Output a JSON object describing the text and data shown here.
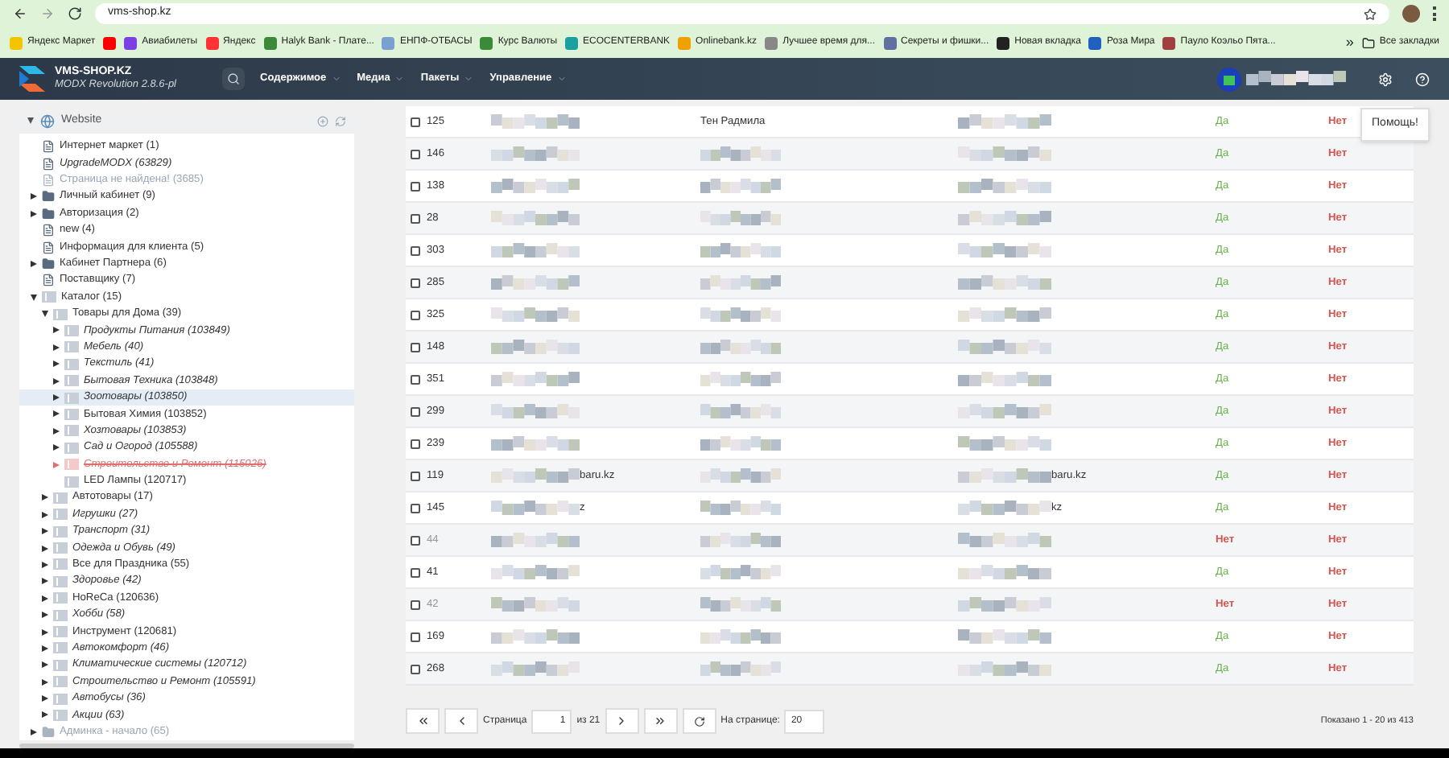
{
  "browser": {
    "address": "vms-shop.kz",
    "bookmarks": [
      {
        "kind": "link",
        "label": "Яндекс Маркет"
      },
      {
        "kind": "icon"
      },
      {
        "kind": "link",
        "label": "Авиабилеты"
      },
      {
        "kind": "link",
        "label": "Яндекс"
      },
      {
        "kind": "link",
        "label": "Halyk Bank - Плате..."
      },
      {
        "kind": "link",
        "label": "ЕНПФ-ОТБАСЫ"
      },
      {
        "kind": "link",
        "label": "Курс Валюты"
      },
      {
        "kind": "link",
        "label": "ECOCENTERBANK"
      },
      {
        "kind": "link",
        "label": "Onlinebank.kz"
      },
      {
        "kind": "link",
        "label": "Лучшее время для..."
      },
      {
        "kind": "link",
        "label": "Секреты и фишки..."
      },
      {
        "kind": "link",
        "label": "Новая вкладка"
      },
      {
        "kind": "link",
        "label": "Роза Мира"
      },
      {
        "kind": "link",
        "label": "Пауло Коэльо Пята..."
      }
    ],
    "more": "»",
    "all_bookmarks": "Все закладки"
  },
  "header": {
    "site": "VMS-SHOP.KZ",
    "version": "MODX Revolution 2.8.6-pl",
    "menu": [
      "Содержимое",
      "Медиа",
      "Пакеты",
      "Управление"
    ]
  },
  "tree": {
    "label": "Website",
    "expanded": true,
    "children": [
      {
        "label": "Интернет маркет (1)",
        "kind": "doc",
        "unpublished": false,
        "hidden": false,
        "deleted": false,
        "selected": false
      },
      {
        "label": "UpgradeMODX (63829)",
        "kind": "doc",
        "unpublished": true,
        "hidden": false,
        "deleted": false,
        "selected": false
      },
      {
        "label": "Страница не найдена! (3685)",
        "kind": "doc",
        "unpublished": false,
        "hidden": true,
        "deleted": false,
        "selected": false
      },
      {
        "label": "Личный кабинет (9)",
        "kind": "folder",
        "unpublished": false,
        "hidden": false,
        "deleted": false,
        "selected": false,
        "expanded": false
      },
      {
        "label": "Авторизация (2)",
        "kind": "folder",
        "unpublished": false,
        "hidden": false,
        "deleted": false,
        "selected": false,
        "expanded": false
      },
      {
        "label": "new (4)",
        "kind": "doc",
        "unpublished": false,
        "hidden": false,
        "deleted": false,
        "selected": false
      },
      {
        "label": "Информация для клиента (5)",
        "kind": "doc",
        "unpublished": false,
        "hidden": false,
        "deleted": false,
        "selected": false
      },
      {
        "label": "Кабинет Партнера (6)",
        "kind": "folder",
        "unpublished": false,
        "hidden": false,
        "deleted": false,
        "selected": false,
        "expanded": false
      },
      {
        "label": "Поставщику (7)",
        "kind": "doc",
        "unpublished": false,
        "hidden": false,
        "deleted": false,
        "selected": false
      },
      {
        "label": "Каталог (15)",
        "kind": "category",
        "unpublished": false,
        "hidden": false,
        "deleted": false,
        "selected": false,
        "expanded": true,
        "children": [
          {
            "label": "Товары для Дома (39)",
            "kind": "category",
            "unpublished": false,
            "hidden": false,
            "deleted": false,
            "selected": false,
            "expanded": true,
            "children": [
              {
                "label": "Продукты Питания (103849)",
                "kind": "category",
                "unpublished": true,
                "hidden": false,
                "deleted": false,
                "selected": false,
                "expanded": false
              },
              {
                "label": "Мебель (40)",
                "kind": "category",
                "unpublished": true,
                "hidden": false,
                "deleted": false,
                "selected": false,
                "expanded": false
              },
              {
                "label": "Текстиль (41)",
                "kind": "category",
                "unpublished": true,
                "hidden": false,
                "deleted": false,
                "selected": false,
                "expanded": false
              },
              {
                "label": "Бытовая Техника (103848)",
                "kind": "category",
                "unpublished": true,
                "hidden": false,
                "deleted": false,
                "selected": false,
                "expanded": false
              },
              {
                "label": "Зоотовары (103850)",
                "kind": "category",
                "unpublished": true,
                "hidden": false,
                "deleted": false,
                "selected": true,
                "expanded": false
              },
              {
                "label": "Бытовая Химия (103852)",
                "kind": "category",
                "unpublished": false,
                "hidden": false,
                "deleted": false,
                "selected": false,
                "expanded": false
              },
              {
                "label": "Хозтовары (103853)",
                "kind": "category",
                "unpublished": true,
                "hidden": false,
                "deleted": false,
                "selected": false,
                "expanded": false
              },
              {
                "label": "Сад и Огород (105588)",
                "kind": "category",
                "unpublished": true,
                "hidden": false,
                "deleted": false,
                "selected": false,
                "expanded": false
              },
              {
                "label": "Строительство и Ремонт (115026)",
                "kind": "category",
                "unpublished": true,
                "hidden": false,
                "deleted": true,
                "selected": false,
                "expanded": false
              },
              {
                "label": "LED Лампы (120717)",
                "kind": "category",
                "unpublished": false,
                "hidden": false,
                "deleted": false,
                "selected": false
              }
            ]
          },
          {
            "label": "Автотовары (17)",
            "kind": "category",
            "unpublished": false,
            "hidden": false,
            "deleted": false,
            "selected": false,
            "expanded": false
          },
          {
            "label": "Игрушки (27)",
            "kind": "category",
            "unpublished": true,
            "hidden": false,
            "deleted": false,
            "selected": false,
            "expanded": false
          },
          {
            "label": "Транспорт (31)",
            "kind": "category",
            "unpublished": true,
            "hidden": false,
            "deleted": false,
            "selected": false,
            "expanded": false
          },
          {
            "label": "Одежда и Обувь (49)",
            "kind": "category",
            "unpublished": true,
            "hidden": false,
            "deleted": false,
            "selected": false,
            "expanded": false
          },
          {
            "label": "Все для Праздника (55)",
            "kind": "category",
            "unpublished": false,
            "hidden": false,
            "deleted": false,
            "selected": false,
            "expanded": false
          },
          {
            "label": "Здоровье (42)",
            "kind": "category",
            "unpublished": true,
            "hidden": false,
            "deleted": false,
            "selected": false,
            "expanded": false
          },
          {
            "label": "HoReCa (120636)",
            "kind": "category",
            "unpublished": false,
            "hidden": false,
            "deleted": false,
            "selected": false,
            "expanded": false
          },
          {
            "label": "Хобби (58)",
            "kind": "category",
            "unpublished": true,
            "hidden": false,
            "deleted": false,
            "selected": false,
            "expanded": false
          },
          {
            "label": "Инструмент (120681)",
            "kind": "category",
            "unpublished": false,
            "hidden": false,
            "deleted": false,
            "selected": false,
            "expanded": false
          },
          {
            "label": "Автокомфорт (46)",
            "kind": "category",
            "unpublished": true,
            "hidden": false,
            "deleted": false,
            "selected": false,
            "expanded": false
          },
          {
            "label": "Климатические системы (120712)",
            "kind": "category",
            "unpublished": true,
            "hidden": false,
            "deleted": false,
            "selected": false,
            "expanded": false
          },
          {
            "label": "Строительство и Ремонт (105591)",
            "kind": "category",
            "unpublished": true,
            "hidden": false,
            "deleted": false,
            "selected": false,
            "expanded": false
          },
          {
            "label": "Автобусы (36)",
            "kind": "category",
            "unpublished": true,
            "hidden": false,
            "deleted": false,
            "selected": false,
            "expanded": false
          },
          {
            "label": "Акции (63)",
            "kind": "category",
            "unpublished": true,
            "hidden": false,
            "deleted": false,
            "selected": false,
            "expanded": false
          }
        ]
      },
      {
        "label": "Админка - начало (65)",
        "kind": "folder",
        "unpublished": false,
        "hidden": true,
        "deleted": false,
        "selected": false,
        "expanded": false
      }
    ]
  },
  "help_button": "Помощь!",
  "table": {
    "rows": [
      {
        "column_1": "125",
        "checked": false,
        "active": true,
        "column_3": "Тен Радмила",
        "column_5": "Да",
        "column_6": "Нет"
      },
      {
        "column_1": "146",
        "checked": false,
        "active": true,
        "column_5": "Да",
        "column_6": "Нет"
      },
      {
        "column_1": "138",
        "checked": false,
        "active": true,
        "column_5": "Да",
        "column_6": "Нет"
      },
      {
        "column_1": "28",
        "checked": false,
        "active": true,
        "column_5": "Да",
        "column_6": "Нет"
      },
      {
        "column_1": "303",
        "checked": false,
        "active": true,
        "column_5": "Да",
        "column_6": "Нет"
      },
      {
        "column_1": "285",
        "checked": false,
        "active": true,
        "column_5": "Да",
        "column_6": "Нет"
      },
      {
        "column_1": "325",
        "checked": false,
        "active": true,
        "column_5": "Да",
        "column_6": "Нет"
      },
      {
        "column_1": "148",
        "checked": false,
        "active": true,
        "column_5": "Да",
        "column_6": "Нет"
      },
      {
        "column_1": "351",
        "checked": false,
        "active": true,
        "column_5": "Да",
        "column_6": "Нет"
      },
      {
        "column_1": "299",
        "checked": false,
        "active": true,
        "column_5": "Да",
        "column_6": "Нет"
      },
      {
        "column_1": "239",
        "checked": false,
        "active": true,
        "column_5": "Да",
        "column_6": "Нет"
      },
      {
        "column_1": "119",
        "checked": false,
        "active": true,
        "column_2": "baru.kz",
        "column_4": "baru.kz",
        "column_5": "Да",
        "column_6": "Нет"
      },
      {
        "column_1": "145",
        "checked": false,
        "active": true,
        "column_2": "z",
        "column_4": "kz",
        "column_5": "Да",
        "column_6": "Нет"
      },
      {
        "column_1": "44",
        "checked": false,
        "active": false,
        "column_5": "Нет",
        "column_6": "Нет"
      },
      {
        "column_1": "41",
        "checked": false,
        "active": true,
        "column_5": "Да",
        "column_6": "Нет"
      },
      {
        "column_1": "42",
        "checked": false,
        "active": false,
        "column_5": "Нет",
        "column_6": "Нет"
      },
      {
        "column_1": "169",
        "checked": false,
        "active": true,
        "column_5": "Да",
        "column_6": "Нет"
      },
      {
        "column_1": "268",
        "checked": false,
        "active": true,
        "column_5": "Да",
        "column_6": "Нет"
      }
    ]
  },
  "pagination": {
    "page_label": "Страница",
    "page": "1",
    "of": "из 21",
    "per_page_label": "На странице:",
    "per_page": "20",
    "summary": "Показано 1 - 20 из 413"
  }
}
